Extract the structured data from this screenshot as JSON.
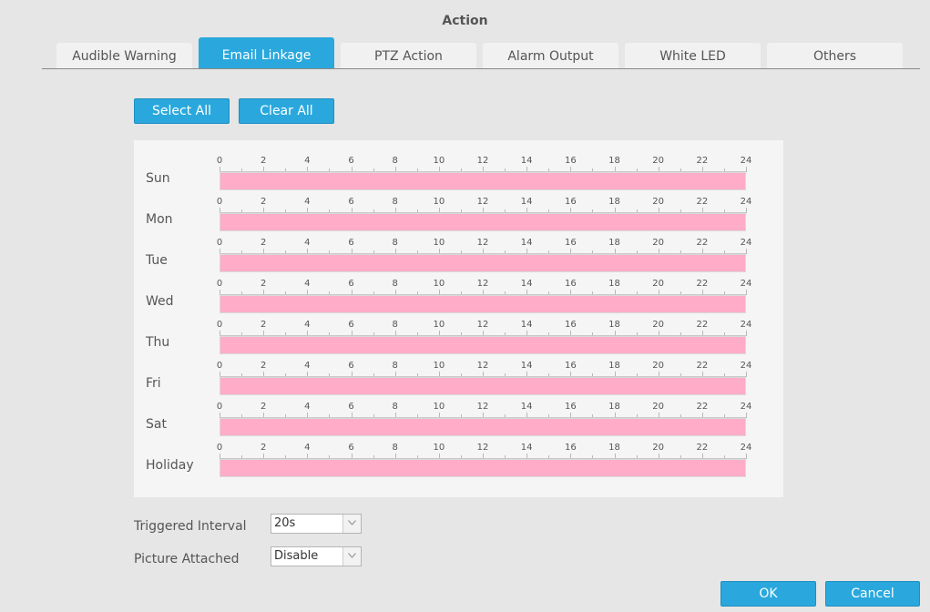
{
  "dialog": {
    "title": "Action"
  },
  "tabs": [
    {
      "label": "Audible Warning",
      "active": false
    },
    {
      "label": "Email Linkage",
      "active": true
    },
    {
      "label": "PTZ Action",
      "active": false
    },
    {
      "label": "Alarm Output",
      "active": false
    },
    {
      "label": "White LED",
      "active": false
    },
    {
      "label": "Others",
      "active": false
    }
  ],
  "toolbar": {
    "select_all": "Select All",
    "clear_all": "Clear All"
  },
  "schedule": {
    "tick_labels": [
      "0",
      "2",
      "4",
      "6",
      "8",
      "10",
      "12",
      "14",
      "16",
      "18",
      "20",
      "22",
      "24"
    ],
    "days": [
      {
        "label": "Sun",
        "ranges": [
          [
            0,
            24
          ]
        ]
      },
      {
        "label": "Mon",
        "ranges": [
          [
            0,
            24
          ]
        ]
      },
      {
        "label": "Tue",
        "ranges": [
          [
            0,
            24
          ]
        ]
      },
      {
        "label": "Wed",
        "ranges": [
          [
            0,
            24
          ]
        ]
      },
      {
        "label": "Thu",
        "ranges": [
          [
            0,
            24
          ]
        ]
      },
      {
        "label": "Fri",
        "ranges": [
          [
            0,
            24
          ]
        ]
      },
      {
        "label": "Sat",
        "ranges": [
          [
            0,
            24
          ]
        ]
      },
      {
        "label": "Holiday",
        "ranges": [
          [
            0,
            24
          ]
        ]
      }
    ],
    "bar_color": "#ffacc8"
  },
  "triggered_interval": {
    "label": "Triggered Interval",
    "value": "20s"
  },
  "picture_attached": {
    "label": "Picture Attached",
    "value": "Disable"
  },
  "footer": {
    "ok": "OK",
    "cancel": "Cancel"
  },
  "colors": {
    "accent": "#2aa8dd",
    "background": "#e6e6e6"
  },
  "icons": {
    "dropdown": "chevron-down-icon"
  }
}
